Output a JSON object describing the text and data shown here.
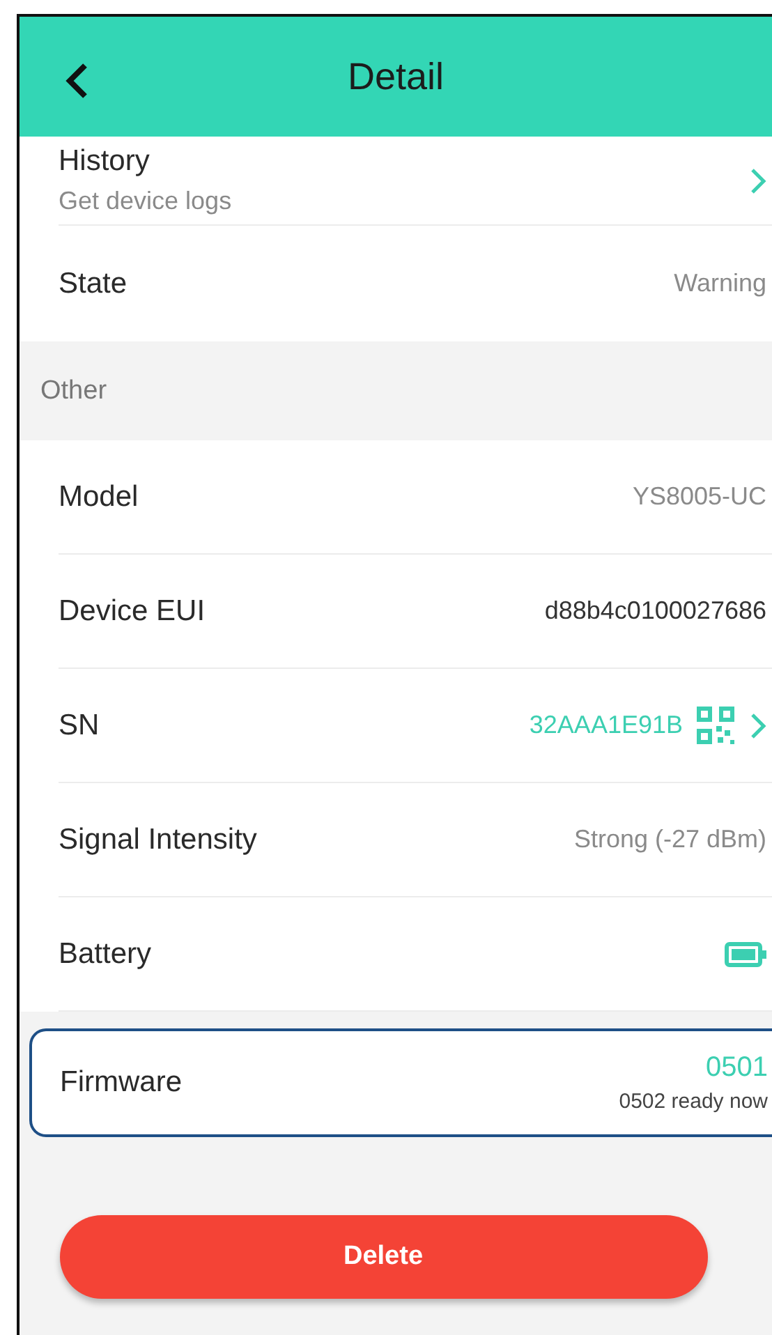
{
  "header": {
    "title": "Detail"
  },
  "top_rows": [
    {
      "kind": "link",
      "label": "History",
      "subtitle": "Get device logs"
    },
    {
      "kind": "text",
      "label": "State",
      "value": "Warning"
    }
  ],
  "section": {
    "title": "Other"
  },
  "rows": [
    {
      "kind": "text",
      "label": "Model",
      "value": "YS8005-UC"
    },
    {
      "kind": "text",
      "label": "Device EUI",
      "value": "d88b4c0100027686",
      "dark": true
    },
    {
      "kind": "code",
      "label": "SN",
      "value": "32AAA1E91B"
    },
    {
      "kind": "text",
      "label": "Signal Intensity",
      "value": "Strong (-27 dBm)"
    },
    {
      "kind": "battery",
      "label": "Battery"
    },
    {
      "kind": "firmware",
      "label": "Firmware",
      "value": "0501",
      "note": "0502 ready now",
      "highlighted": true
    }
  ],
  "delete_button": "Delete"
}
